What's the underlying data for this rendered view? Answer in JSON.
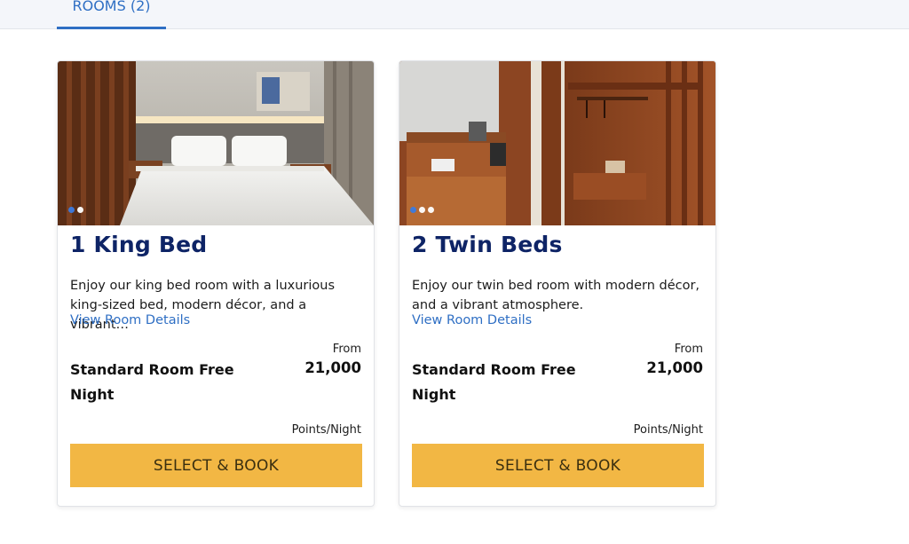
{
  "tabs": {
    "rooms_label": "ROOMS (2)"
  },
  "cards": [
    {
      "title": "1 King Bed",
      "description": "Enjoy our king bed room with a luxurious king-sized bed, modern décor, and a vibrant…",
      "details_link": "View Room Details",
      "from_label": "From",
      "rate_name": "Standard Room Free Night",
      "price": "21,000",
      "unit": "Points/Night",
      "button": "SELECT & BOOK",
      "carousel": {
        "count": 2,
        "active": 1
      }
    },
    {
      "title": "2 Twin Beds",
      "description": "Enjoy our twin bed room with modern décor, and a vibrant atmosphere.",
      "details_link": "View Room Details",
      "from_label": "From",
      "rate_name": "Standard Room Free Night",
      "price": "21,000",
      "unit": "Points/Night",
      "button": "SELECT & BOOK",
      "carousel": {
        "count": 3,
        "active": 1
      }
    }
  ],
  "colors": {
    "accent_blue": "#2f6fc4",
    "title_navy": "#0e2466",
    "button_yellow": "#f2b744"
  }
}
